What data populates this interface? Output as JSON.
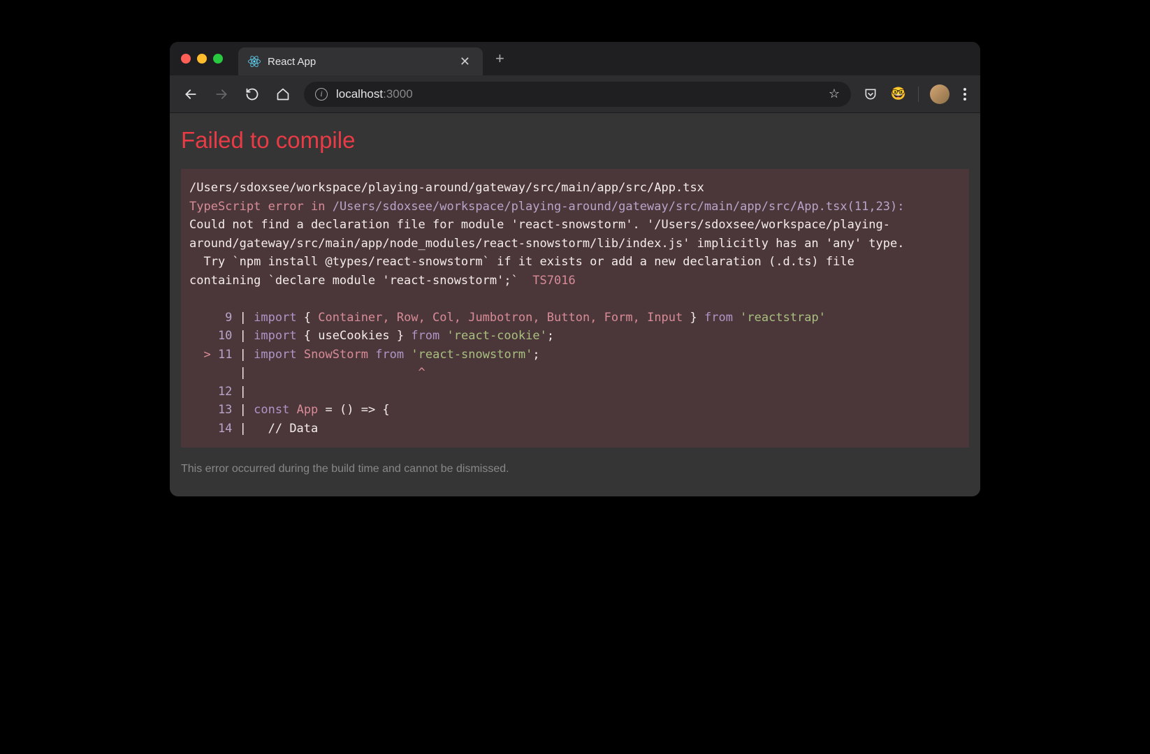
{
  "tab": {
    "title": "React App"
  },
  "address": {
    "host": "localhost",
    "port": ":3000"
  },
  "error": {
    "title": "Failed to compile",
    "file_path": "/Users/sdoxsee/workspace/playing-around/gateway/src/main/app/src/App.tsx",
    "ts_error_label": "TypeScript error in ",
    "ts_error_path": "/Users/sdoxsee/workspace/playing-around/gateway/src/main/app/src/App.tsx",
    "ts_error_loc": "(11,23)",
    "message_l1": "Could not find a declaration file for module 'react-snowstorm'. '/Users/sdoxsee/workspace/playing-",
    "message_l2": "around/gateway/src/main/app/node_modules/react-snowstorm/lib/index.js' implicitly has an 'any' type.",
    "message_l3": "  Try `npm install @types/react-snowstorm` if it exists or add a new declaration (.d.ts) file",
    "message_l4": "containing `declare module 'react-snowstorm';`  ",
    "ts_code": "TS7016",
    "code": {
      "l9_num": "     9",
      "l9_a": "import",
      "l9_b": " { ",
      "l9_c": "Container, Row, Col, Jumbotron, Button, Form, Input",
      "l9_d": " } ",
      "l9_e": "from",
      "l9_f": " 'reactstrap'",
      "l10_num": "    10",
      "l10_a": "import",
      "l10_b": " { useCookies } ",
      "l10_c": "from",
      "l10_d": " ",
      "l10_e": "'react-cookie'",
      "l10_f": ";",
      "l11_mark": "  >",
      "l11_num": " 11",
      "l11_a": "import",
      "l11_b": " ",
      "l11_c": "SnowStorm",
      "l11_d": " ",
      "l11_e": "from",
      "l11_f": " ",
      "l11_g": "'react-snowstorm'",
      "l11_h": ";",
      "caret_pad": "      ",
      "caret_line": "                       ",
      "caret_sym": "^",
      "l12_num": "    12",
      "l13_num": "    13",
      "l13_a": "const",
      "l13_b": " ",
      "l13_c": "App",
      "l13_d": " = () => {",
      "l14_num": "    14",
      "l14_a": "  // Data"
    },
    "footer": "This error occurred during the build time and cannot be dismissed."
  }
}
